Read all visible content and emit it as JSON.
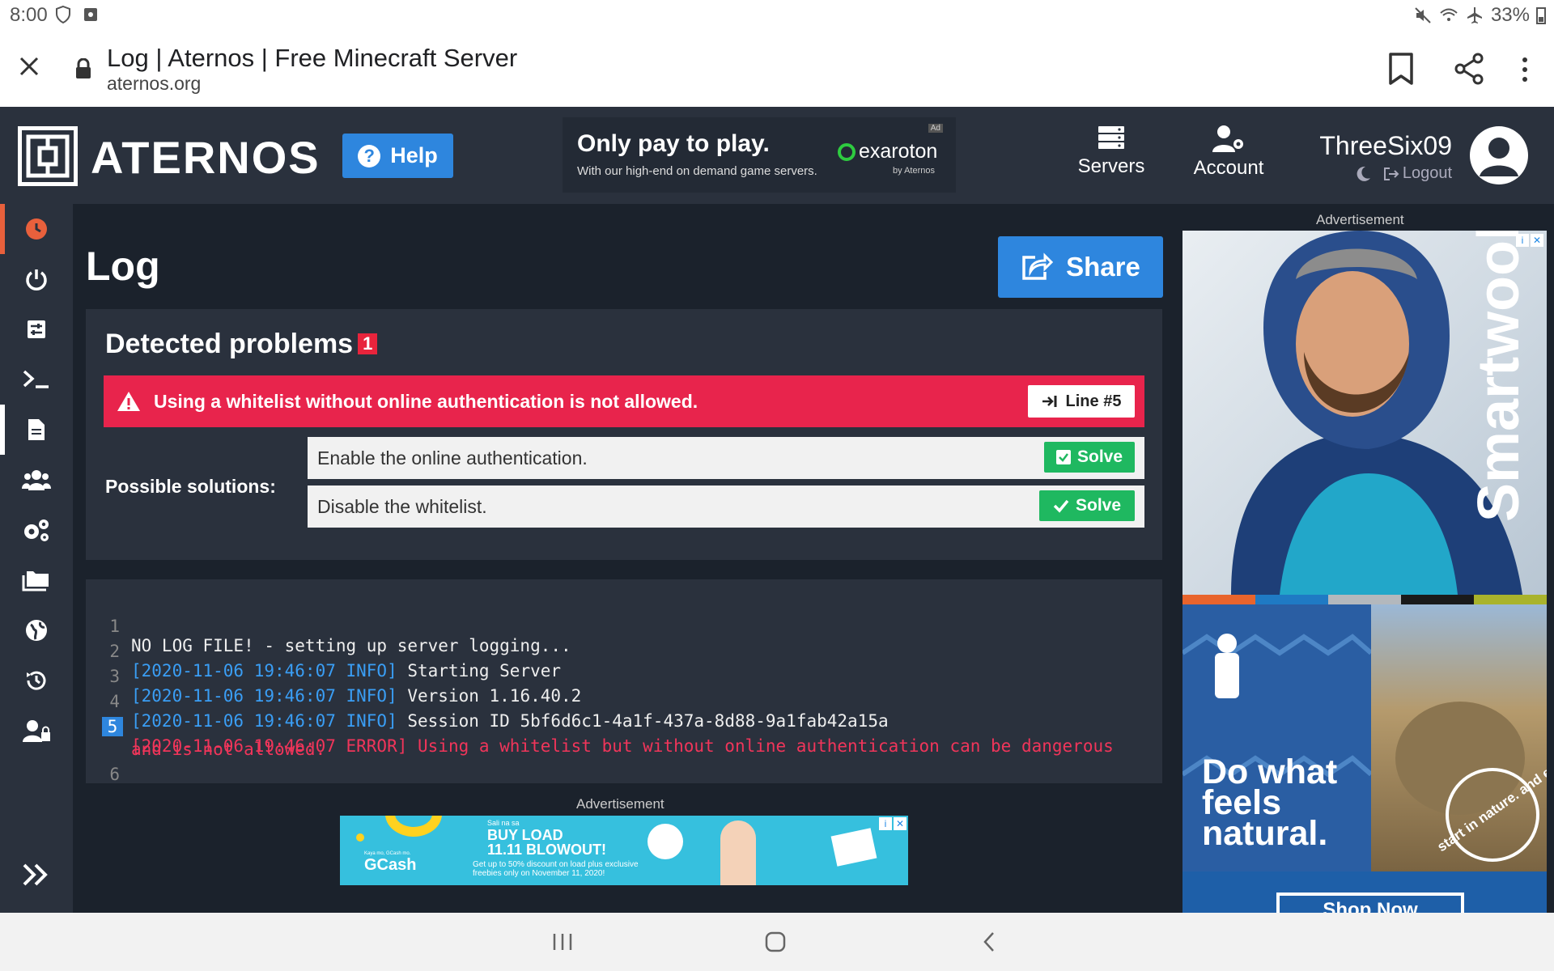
{
  "status_bar": {
    "time": "8:00",
    "battery": "33%"
  },
  "browser": {
    "title": "Log | Aternos | Free Minecraft Server",
    "url": "aternos.org"
  },
  "header": {
    "logo_text": "ATERNOS",
    "help_label": "Help",
    "promo": {
      "headline": "Only pay to play.",
      "subline": "With our high-end on demand game servers.",
      "brand": "exaroton",
      "brand_sub": "by Aternos",
      "ad_tag": "Ad"
    },
    "nav": {
      "servers": "Servers",
      "account": "Account"
    },
    "user": {
      "name": "ThreeSix09",
      "logout": "Logout"
    }
  },
  "page": {
    "title": "Log",
    "share_label": "Share"
  },
  "problems": {
    "heading": "Detected problems",
    "count": "1",
    "error_text": "Using a whitelist without online authentication is not allowed.",
    "line_button": "Line #5",
    "solutions_label": "Possible solutions:",
    "solutions": [
      {
        "text": "Enable the online authentication.",
        "button": "Solve"
      },
      {
        "text": "Disable the whitelist.",
        "button": "Solve"
      }
    ]
  },
  "log": {
    "lines": [
      {
        "n": "1",
        "ts": "",
        "text": "NO LOG FILE! - setting up server logging..."
      },
      {
        "n": "2",
        "ts": "[2020-11-06 19:46:07 INFO]",
        "text": " Starting Server"
      },
      {
        "n": "3",
        "ts": "[2020-11-06 19:46:07 INFO]",
        "text": " Version 1.16.40.2"
      },
      {
        "n": "4",
        "ts": "[2020-11-06 19:46:07 INFO]",
        "text": " Session ID 5bf6d6c1-4a1f-437a-8d88-9a1fab42a15a"
      },
      {
        "n": "5",
        "ts": "[2020-11-06 19:46:07 ERROR]",
        "text": " Using a whitelist but without online authentication can be dangerous",
        "cont": "and is not allowed."
      },
      {
        "n": "6",
        "ts": "",
        "text": ""
      }
    ]
  },
  "ads": {
    "label": "Advertisement",
    "bottom": {
      "brand": "GCash",
      "small": "Kaya mo, GCash mo.",
      "l1": "Sali na sa",
      "l2": "BUY LOAD",
      "l3": "11.11 BLOWOUT!",
      "l4": "Get up to 50% discount on load plus exclusive freebies only on November 11, 2020!"
    },
    "right": {
      "brand": "Smartwool",
      "tagline_1": "Do what",
      "tagline_2": "feels",
      "tagline_3": "natural.",
      "circle_text": "start in nature. and end",
      "cta": "Shop Now"
    }
  }
}
